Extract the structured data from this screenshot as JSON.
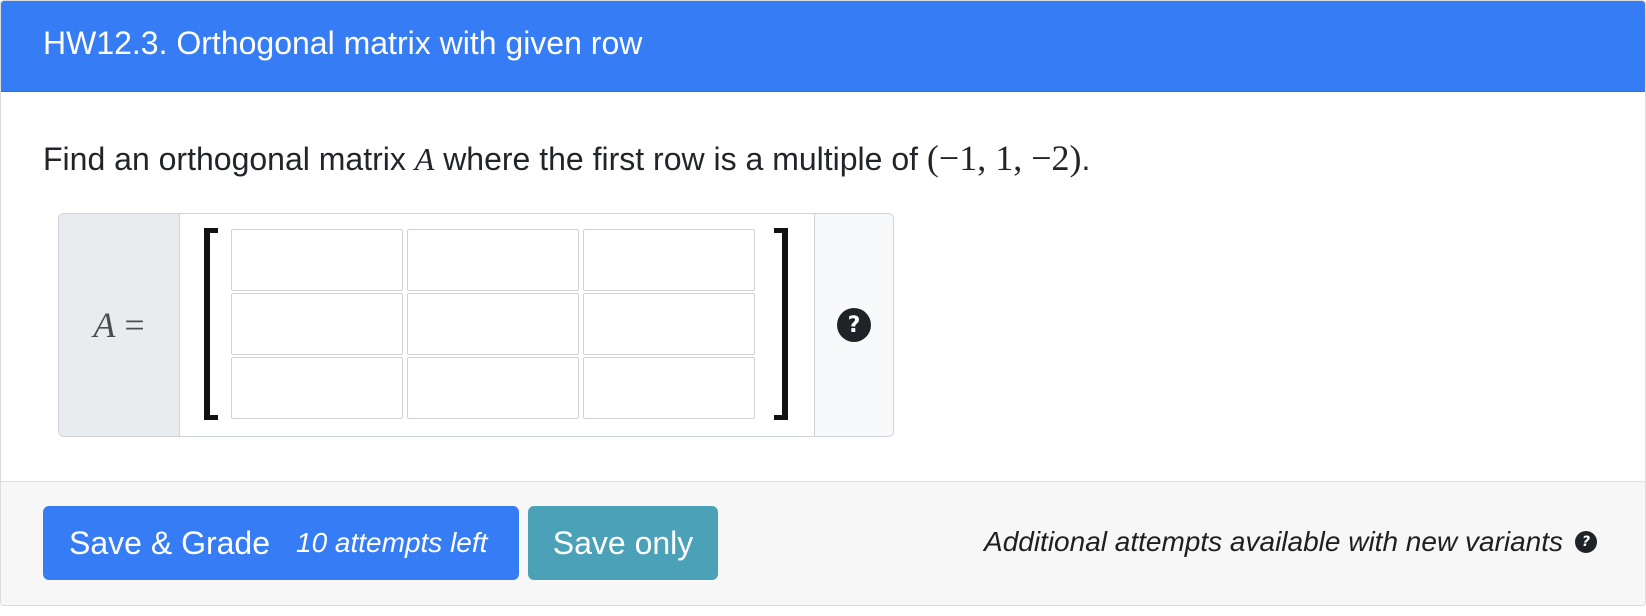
{
  "header": {
    "title": "HW12.3. Orthogonal matrix with given row"
  },
  "question": {
    "text_before": "Find an orthogonal matrix ",
    "matrix_symbol": "A",
    "text_middle": " where the first row is a multiple of ",
    "vector": "(−1, 1, −2)",
    "text_end": "."
  },
  "answer": {
    "label_symbol": "A",
    "label_eq": " =",
    "matrix_rows": [
      [
        "",
        "",
        ""
      ],
      [
        "",
        "",
        ""
      ],
      [
        "",
        "",
        ""
      ]
    ],
    "help_icon": "question-circle-icon",
    "help_glyph": "?"
  },
  "footer": {
    "save_grade_label": "Save & Grade",
    "attempts_left": "10 attempts left",
    "save_only_label": "Save only",
    "note": "Additional attempts available with new variants",
    "note_icon": "question-circle-icon",
    "note_glyph": "?"
  },
  "colors": {
    "header_bg": "#367cf5",
    "grade_button": "#367cf5",
    "save_button": "#4ba1b7",
    "footer_bg": "#f7f7f7"
  }
}
